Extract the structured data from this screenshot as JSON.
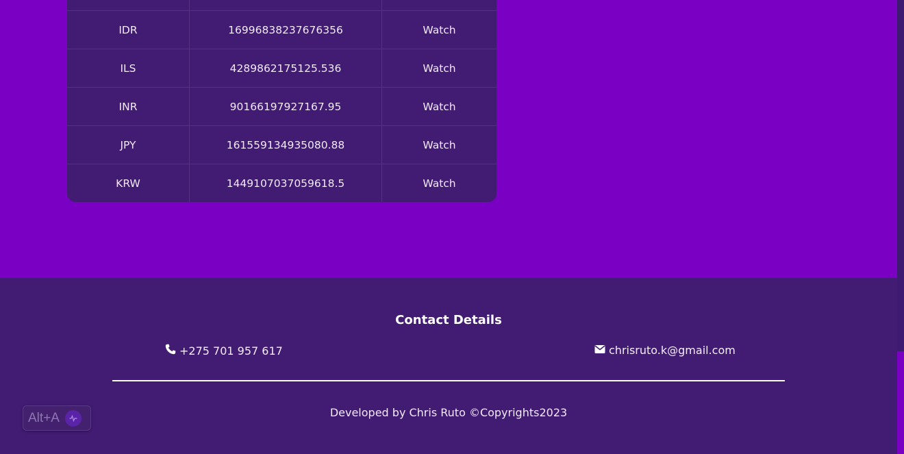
{
  "table": {
    "rows": [
      {
        "currency": "",
        "amount": "",
        "action": ""
      },
      {
        "currency": "IDR",
        "amount": "16996838237676356",
        "action": "Watch"
      },
      {
        "currency": "ILS",
        "amount": "4289862175125.536",
        "action": "Watch"
      },
      {
        "currency": "INR",
        "amount": "90166197927167.95",
        "action": "Watch"
      },
      {
        "currency": "JPY",
        "amount": "161559134935080.88",
        "action": "Watch"
      },
      {
        "currency": "KRW",
        "amount": "1449107037059618.5",
        "action": "Watch"
      }
    ]
  },
  "footer": {
    "title": "Contact Details",
    "phone": "+275 701 957 617",
    "email": "chrisruto.k@gmail.com",
    "copyright": "Developed by Chris Ruto ©Copyrights2023"
  },
  "widget": {
    "shortcut": "Alt+A",
    "icon": "voice-wave-icon"
  },
  "colors": {
    "page_bg": "#7a00c4",
    "panel_bg": "#421b73",
    "text": "#f4eefa"
  }
}
